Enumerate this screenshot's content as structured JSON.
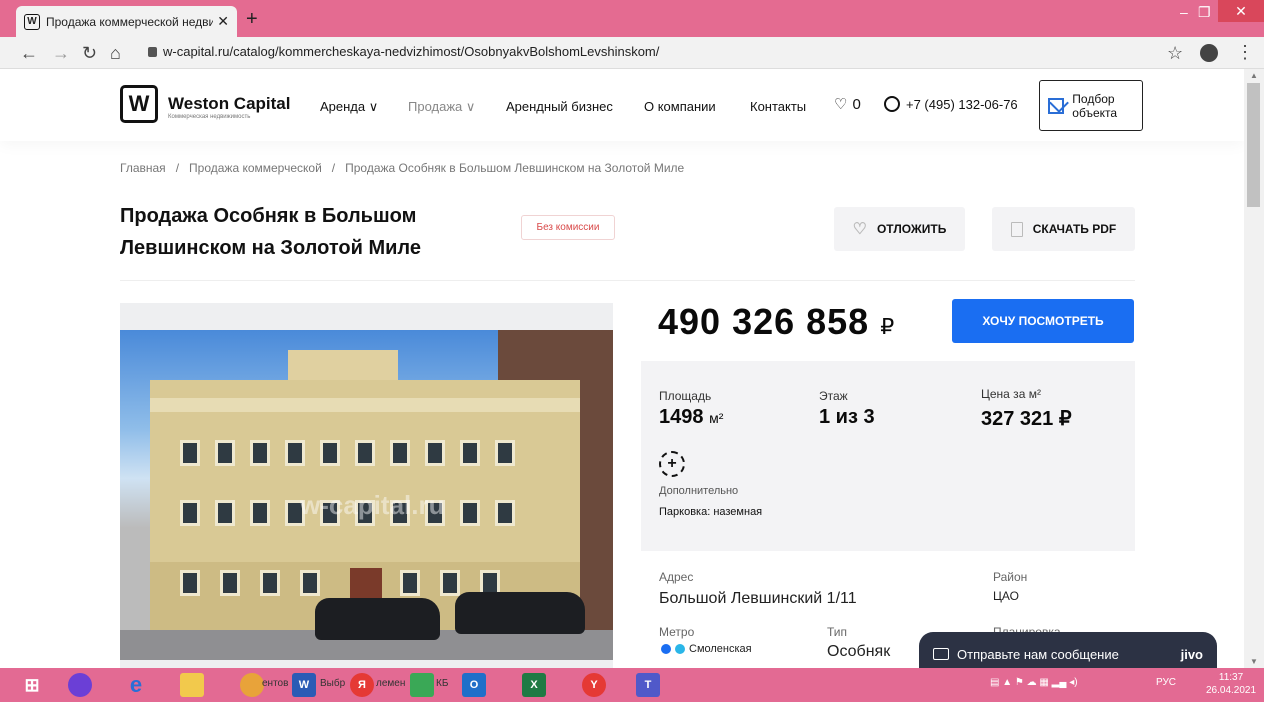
{
  "browser": {
    "tab_title": "Продажа коммерческой недви",
    "tab_favicon": "W",
    "url": "w-capital.ru/catalog/kommercheskaya-nedvizhimost/OsobnyakvBolshomLevshinskom/",
    "titlebar_color": "#e46b91"
  },
  "header": {
    "logo_mark": "W",
    "brand": "Weston Capital",
    "brand_sub": "Коммерческая недвижимость",
    "menu": [
      {
        "label": "Аренда ∨"
      },
      {
        "label": "Продажа ∨"
      },
      {
        "label": "Арендный бизнес"
      },
      {
        "label": "О компании"
      },
      {
        "label": "Контакты"
      }
    ],
    "favorites_count": "0",
    "phone": "+7 (495) 132-06-76",
    "pick_button": "Подбор объекта"
  },
  "breadcrumb": {
    "items": [
      "Главная",
      "/",
      "Продажа коммерческой",
      "/",
      "Продажа Особняк в Большом Левшинском на Золотой Миле"
    ]
  },
  "listing": {
    "title": "Продажа Особняк в Большом Левшинском на Золотой Миле",
    "badge": "Без комиссии",
    "save_button": "ОТЛОЖИТЬ",
    "pdf_button": "СКАЧАТЬ PDF",
    "photo_watermark": "w-capital.ru",
    "price": "490 326 858",
    "currency": "₽",
    "cta_button": "ХОЧУ ПОСМОТРЕТЬ",
    "area_label": "Площадь",
    "area_value": "1498",
    "area_unit": "м²",
    "floor_label": "Этаж",
    "floor_value": "1 из 3",
    "ppm_label": "Цена за м²",
    "ppm_value": "327 321 ₽",
    "extra_label": "Дополнительно",
    "extra_value": "Парковка: наземная",
    "address_label": "Адрес",
    "address_value": "Большой Левшинский 1/11",
    "district_label": "Район",
    "district_value": "ЦАО",
    "metro_label": "Метро",
    "metro_value": "Смоленская",
    "type_label": "Тип",
    "type_value": "Особняк",
    "layout_label": "Планировка",
    "accent_color": "#1a6ef2"
  },
  "chat": {
    "label": "Отправьте нам сообщение",
    "brand": "jivo"
  },
  "taskbar": {
    "items": [
      "ентов",
      "Выбр",
      "лемен",
      "КБ"
    ],
    "lang": "РУС",
    "time": "11:37",
    "date": "26.04.2021"
  }
}
